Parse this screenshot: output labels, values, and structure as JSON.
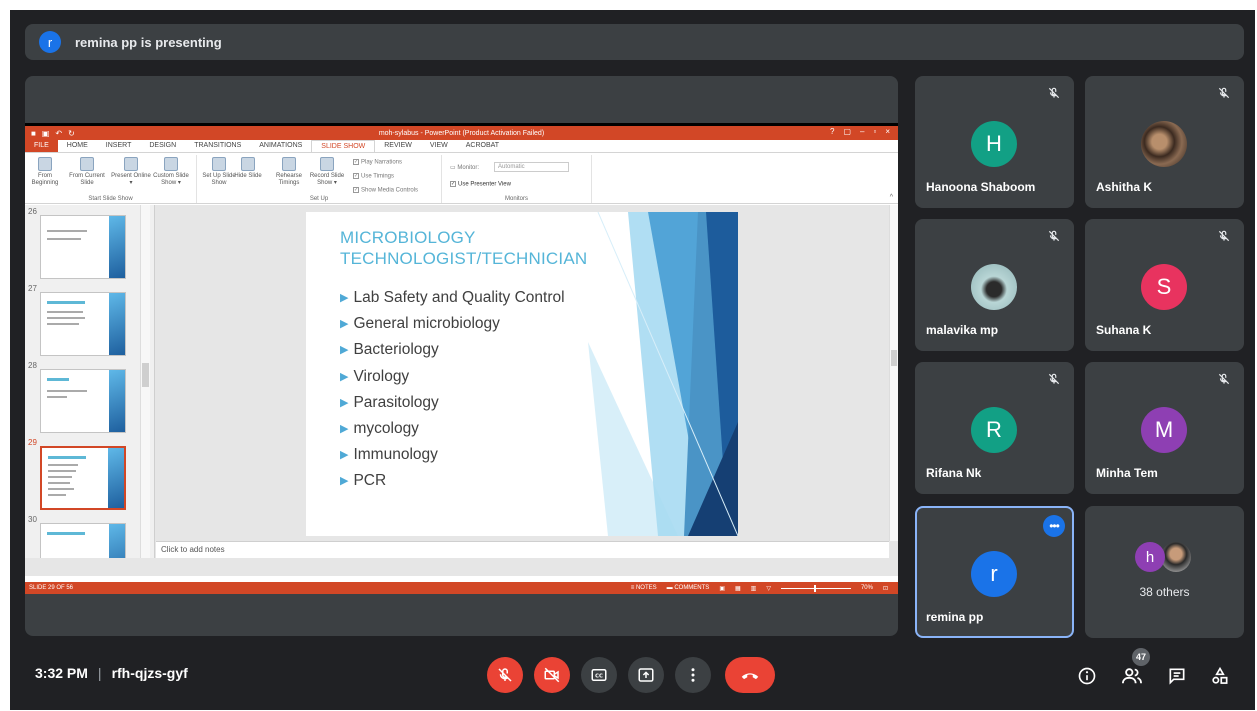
{
  "presenting": {
    "avatar_letter": "r",
    "text": "remina pp is presenting"
  },
  "powerpoint": {
    "title": "moh-sylabus - PowerPoint (Product Activation Failed)",
    "window_controls": [
      "?",
      "▢",
      "–",
      "▫",
      "×"
    ],
    "tabs": [
      "FILE",
      "HOME",
      "INSERT",
      "DESIGN",
      "TRANSITIONS",
      "ANIMATIONS",
      "SLIDE SHOW",
      "REVIEW",
      "VIEW",
      "ACROBAT"
    ],
    "active_tab": "SLIDE SHOW",
    "ribbon": {
      "start_group_label": "Start Slide Show",
      "setup_group_label": "Set Up",
      "monitors_group_label": "Monitors",
      "buttons": {
        "from_beginning": "From Beginning",
        "from_current": "From Current Slide",
        "present_online": "Present Online ▾",
        "custom_show": "Custom Slide Show ▾",
        "set_up": "Set Up Slide Show",
        "hide_slide": "Hide Slide",
        "rehearse": "Rehearse Timings",
        "record": "Record Slide Show ▾"
      },
      "checks": {
        "play_narrations": "Play Narrations",
        "use_timings": "Use Timings",
        "show_media": "Show Media Controls",
        "presenter_view": "Use Presenter View"
      },
      "monitor_label": "Monitor:",
      "monitor_value": "Automatic"
    },
    "thumbnails": [
      {
        "number": "26"
      },
      {
        "number": "27"
      },
      {
        "number": "28"
      },
      {
        "number": "29",
        "selected": true
      },
      {
        "number": "30"
      }
    ],
    "slide": {
      "title_line1": "MICROBIOLOGY",
      "title_line2": "TECHNOLOGIST/TECHNICIAN",
      "bullets": [
        "Lab Safety and Quality Control",
        "General microbiology",
        "Bacteriology",
        "Virology",
        "Parasitology",
        "mycology",
        "Immunology",
        "PCR"
      ]
    },
    "notes_placeholder": "Click to add notes",
    "status": {
      "slide_info": "SLIDE 29 OF 56",
      "notes": "NOTES",
      "comments": "COMMENTS",
      "zoom": "70%"
    }
  },
  "participants": [
    {
      "name": "Hanoona Shaboom",
      "letter": "H",
      "color": "#12a085",
      "muted": true
    },
    {
      "name": "Ashitha K",
      "letter": "",
      "color": "#6d5a48",
      "muted": true,
      "photo": true
    },
    {
      "name": "malavika mp",
      "letter": "",
      "color": "#b9d6d6",
      "muted": true,
      "photo": true
    },
    {
      "name": "Suhana K",
      "letter": "S",
      "color": "#e8335f",
      "muted": true
    },
    {
      "name": "Rifana Nk",
      "letter": "R",
      "color": "#12a085",
      "muted": true
    },
    {
      "name": "Minha Tem",
      "letter": "M",
      "color": "#8e3fb3",
      "muted": true
    },
    {
      "name": "remina pp",
      "letter": "r",
      "color": "#1a73e8",
      "self": true
    }
  ],
  "others": {
    "avatar_letter": "h",
    "label": "38 others"
  },
  "meeting": {
    "time": "3:32 PM",
    "separator": "|",
    "code": "rfh-qjzs-gyf",
    "participant_count": "47"
  },
  "colors": {
    "background": "#202124",
    "tile": "#3c4043",
    "red": "#ea4335",
    "ppt_accent": "#d24726"
  }
}
